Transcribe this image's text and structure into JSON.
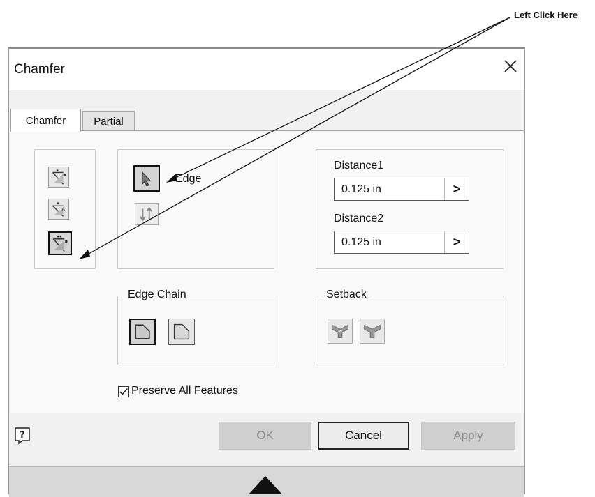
{
  "callout": {
    "text": "Left Click Here"
  },
  "dialog": {
    "title": "Chamfer",
    "tabs": [
      {
        "label": "Chamfer",
        "active": true
      },
      {
        "label": "Partial",
        "active": false
      }
    ],
    "method_icons": [
      "distance-icon",
      "distance-angle-icon",
      "two-distances-icon"
    ],
    "edge": {
      "label": "Edge",
      "flip_icon": "flip-direction-icon"
    },
    "distance1": {
      "label": "Distance1",
      "value": "0.125 in"
    },
    "distance2": {
      "label": "Distance2",
      "value": "0.125 in"
    },
    "edge_chain": {
      "label": "Edge Chain",
      "icons": [
        "all-tangent-edges-icon",
        "single-edge-icon"
      ]
    },
    "setback": {
      "label": "Setback",
      "icons": [
        "setback-on-icon",
        "setback-off-icon"
      ]
    },
    "preserve": {
      "label": "Preserve All Features",
      "checked": true
    },
    "buttons": {
      "ok": "OK",
      "cancel": "Cancel",
      "apply": "Apply"
    }
  }
}
